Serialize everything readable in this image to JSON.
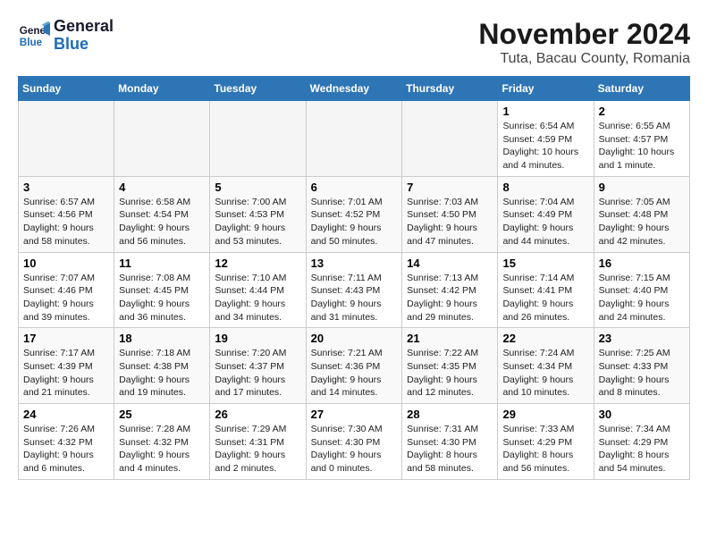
{
  "header": {
    "logo_line1": "General",
    "logo_line2": "Blue",
    "month": "November 2024",
    "location": "Tuta, Bacau County, Romania"
  },
  "weekdays": [
    "Sunday",
    "Monday",
    "Tuesday",
    "Wednesday",
    "Thursday",
    "Friday",
    "Saturday"
  ],
  "weeks": [
    [
      {
        "day": "",
        "info": ""
      },
      {
        "day": "",
        "info": ""
      },
      {
        "day": "",
        "info": ""
      },
      {
        "day": "",
        "info": ""
      },
      {
        "day": "",
        "info": ""
      },
      {
        "day": "1",
        "info": "Sunrise: 6:54 AM\nSunset: 4:59 PM\nDaylight: 10 hours\nand 4 minutes."
      },
      {
        "day": "2",
        "info": "Sunrise: 6:55 AM\nSunset: 4:57 PM\nDaylight: 10 hours\nand 1 minute."
      }
    ],
    [
      {
        "day": "3",
        "info": "Sunrise: 6:57 AM\nSunset: 4:56 PM\nDaylight: 9 hours\nand 58 minutes."
      },
      {
        "day": "4",
        "info": "Sunrise: 6:58 AM\nSunset: 4:54 PM\nDaylight: 9 hours\nand 56 minutes."
      },
      {
        "day": "5",
        "info": "Sunrise: 7:00 AM\nSunset: 4:53 PM\nDaylight: 9 hours\nand 53 minutes."
      },
      {
        "day": "6",
        "info": "Sunrise: 7:01 AM\nSunset: 4:52 PM\nDaylight: 9 hours\nand 50 minutes."
      },
      {
        "day": "7",
        "info": "Sunrise: 7:03 AM\nSunset: 4:50 PM\nDaylight: 9 hours\nand 47 minutes."
      },
      {
        "day": "8",
        "info": "Sunrise: 7:04 AM\nSunset: 4:49 PM\nDaylight: 9 hours\nand 44 minutes."
      },
      {
        "day": "9",
        "info": "Sunrise: 7:05 AM\nSunset: 4:48 PM\nDaylight: 9 hours\nand 42 minutes."
      }
    ],
    [
      {
        "day": "10",
        "info": "Sunrise: 7:07 AM\nSunset: 4:46 PM\nDaylight: 9 hours\nand 39 minutes."
      },
      {
        "day": "11",
        "info": "Sunrise: 7:08 AM\nSunset: 4:45 PM\nDaylight: 9 hours\nand 36 minutes."
      },
      {
        "day": "12",
        "info": "Sunrise: 7:10 AM\nSunset: 4:44 PM\nDaylight: 9 hours\nand 34 minutes."
      },
      {
        "day": "13",
        "info": "Sunrise: 7:11 AM\nSunset: 4:43 PM\nDaylight: 9 hours\nand 31 minutes."
      },
      {
        "day": "14",
        "info": "Sunrise: 7:13 AM\nSunset: 4:42 PM\nDaylight: 9 hours\nand 29 minutes."
      },
      {
        "day": "15",
        "info": "Sunrise: 7:14 AM\nSunset: 4:41 PM\nDaylight: 9 hours\nand 26 minutes."
      },
      {
        "day": "16",
        "info": "Sunrise: 7:15 AM\nSunset: 4:40 PM\nDaylight: 9 hours\nand 24 minutes."
      }
    ],
    [
      {
        "day": "17",
        "info": "Sunrise: 7:17 AM\nSunset: 4:39 PM\nDaylight: 9 hours\nand 21 minutes."
      },
      {
        "day": "18",
        "info": "Sunrise: 7:18 AM\nSunset: 4:38 PM\nDaylight: 9 hours\nand 19 minutes."
      },
      {
        "day": "19",
        "info": "Sunrise: 7:20 AM\nSunset: 4:37 PM\nDaylight: 9 hours\nand 17 minutes."
      },
      {
        "day": "20",
        "info": "Sunrise: 7:21 AM\nSunset: 4:36 PM\nDaylight: 9 hours\nand 14 minutes."
      },
      {
        "day": "21",
        "info": "Sunrise: 7:22 AM\nSunset: 4:35 PM\nDaylight: 9 hours\nand 12 minutes."
      },
      {
        "day": "22",
        "info": "Sunrise: 7:24 AM\nSunset: 4:34 PM\nDaylight: 9 hours\nand 10 minutes."
      },
      {
        "day": "23",
        "info": "Sunrise: 7:25 AM\nSunset: 4:33 PM\nDaylight: 9 hours\nand 8 minutes."
      }
    ],
    [
      {
        "day": "24",
        "info": "Sunrise: 7:26 AM\nSunset: 4:32 PM\nDaylight: 9 hours\nand 6 minutes."
      },
      {
        "day": "25",
        "info": "Sunrise: 7:28 AM\nSunset: 4:32 PM\nDaylight: 9 hours\nand 4 minutes."
      },
      {
        "day": "26",
        "info": "Sunrise: 7:29 AM\nSunset: 4:31 PM\nDaylight: 9 hours\nand 2 minutes."
      },
      {
        "day": "27",
        "info": "Sunrise: 7:30 AM\nSunset: 4:30 PM\nDaylight: 9 hours\nand 0 minutes."
      },
      {
        "day": "28",
        "info": "Sunrise: 7:31 AM\nSunset: 4:30 PM\nDaylight: 8 hours\nand 58 minutes."
      },
      {
        "day": "29",
        "info": "Sunrise: 7:33 AM\nSunset: 4:29 PM\nDaylight: 8 hours\nand 56 minutes."
      },
      {
        "day": "30",
        "info": "Sunrise: 7:34 AM\nSunset: 4:29 PM\nDaylight: 8 hours\nand 54 minutes."
      }
    ]
  ]
}
